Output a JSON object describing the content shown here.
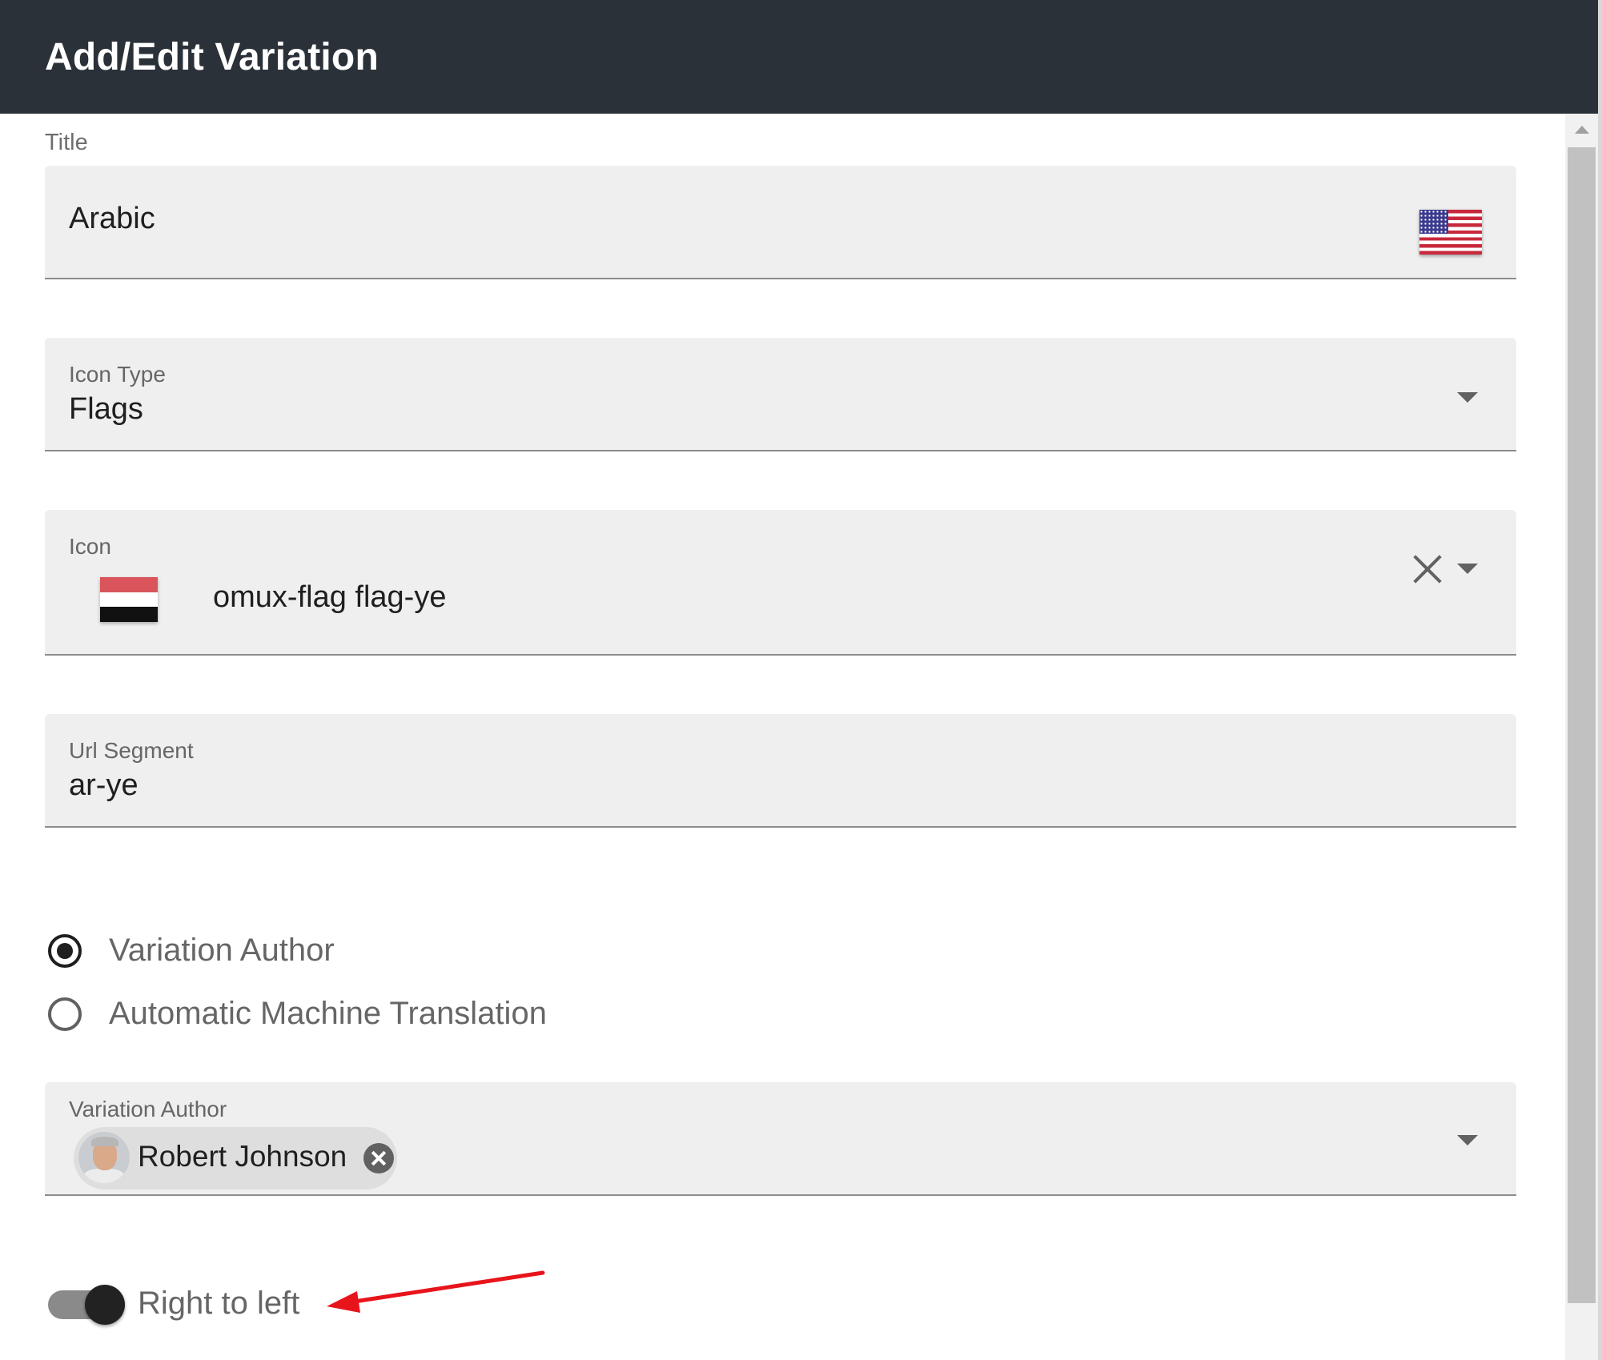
{
  "dialog": {
    "title": "Add/Edit Variation"
  },
  "title_field": {
    "label": "Title",
    "value": "Arabic",
    "flag_icon": "us-flag-icon"
  },
  "icon_type_field": {
    "label": "Icon Type",
    "value": "Flags"
  },
  "icon_field": {
    "label": "Icon",
    "value": "omux-flag flag-ye",
    "flag_icon": "ye-flag-icon"
  },
  "url_segment_field": {
    "label": "Url Segment",
    "value": "ar-ye"
  },
  "translation_mode": {
    "options": [
      {
        "label": "Variation Author",
        "selected": true
      },
      {
        "label": "Automatic Machine Translation",
        "selected": false
      }
    ]
  },
  "variation_author_field": {
    "label": "Variation Author",
    "chips": [
      {
        "name": "Robert Johnson"
      }
    ]
  },
  "rtl_toggle": {
    "label": "Right to left",
    "on": true
  },
  "colors": {
    "header_bg": "#2b3138",
    "field_bg": "#efefef",
    "annotation_arrow": "#e8141c"
  }
}
